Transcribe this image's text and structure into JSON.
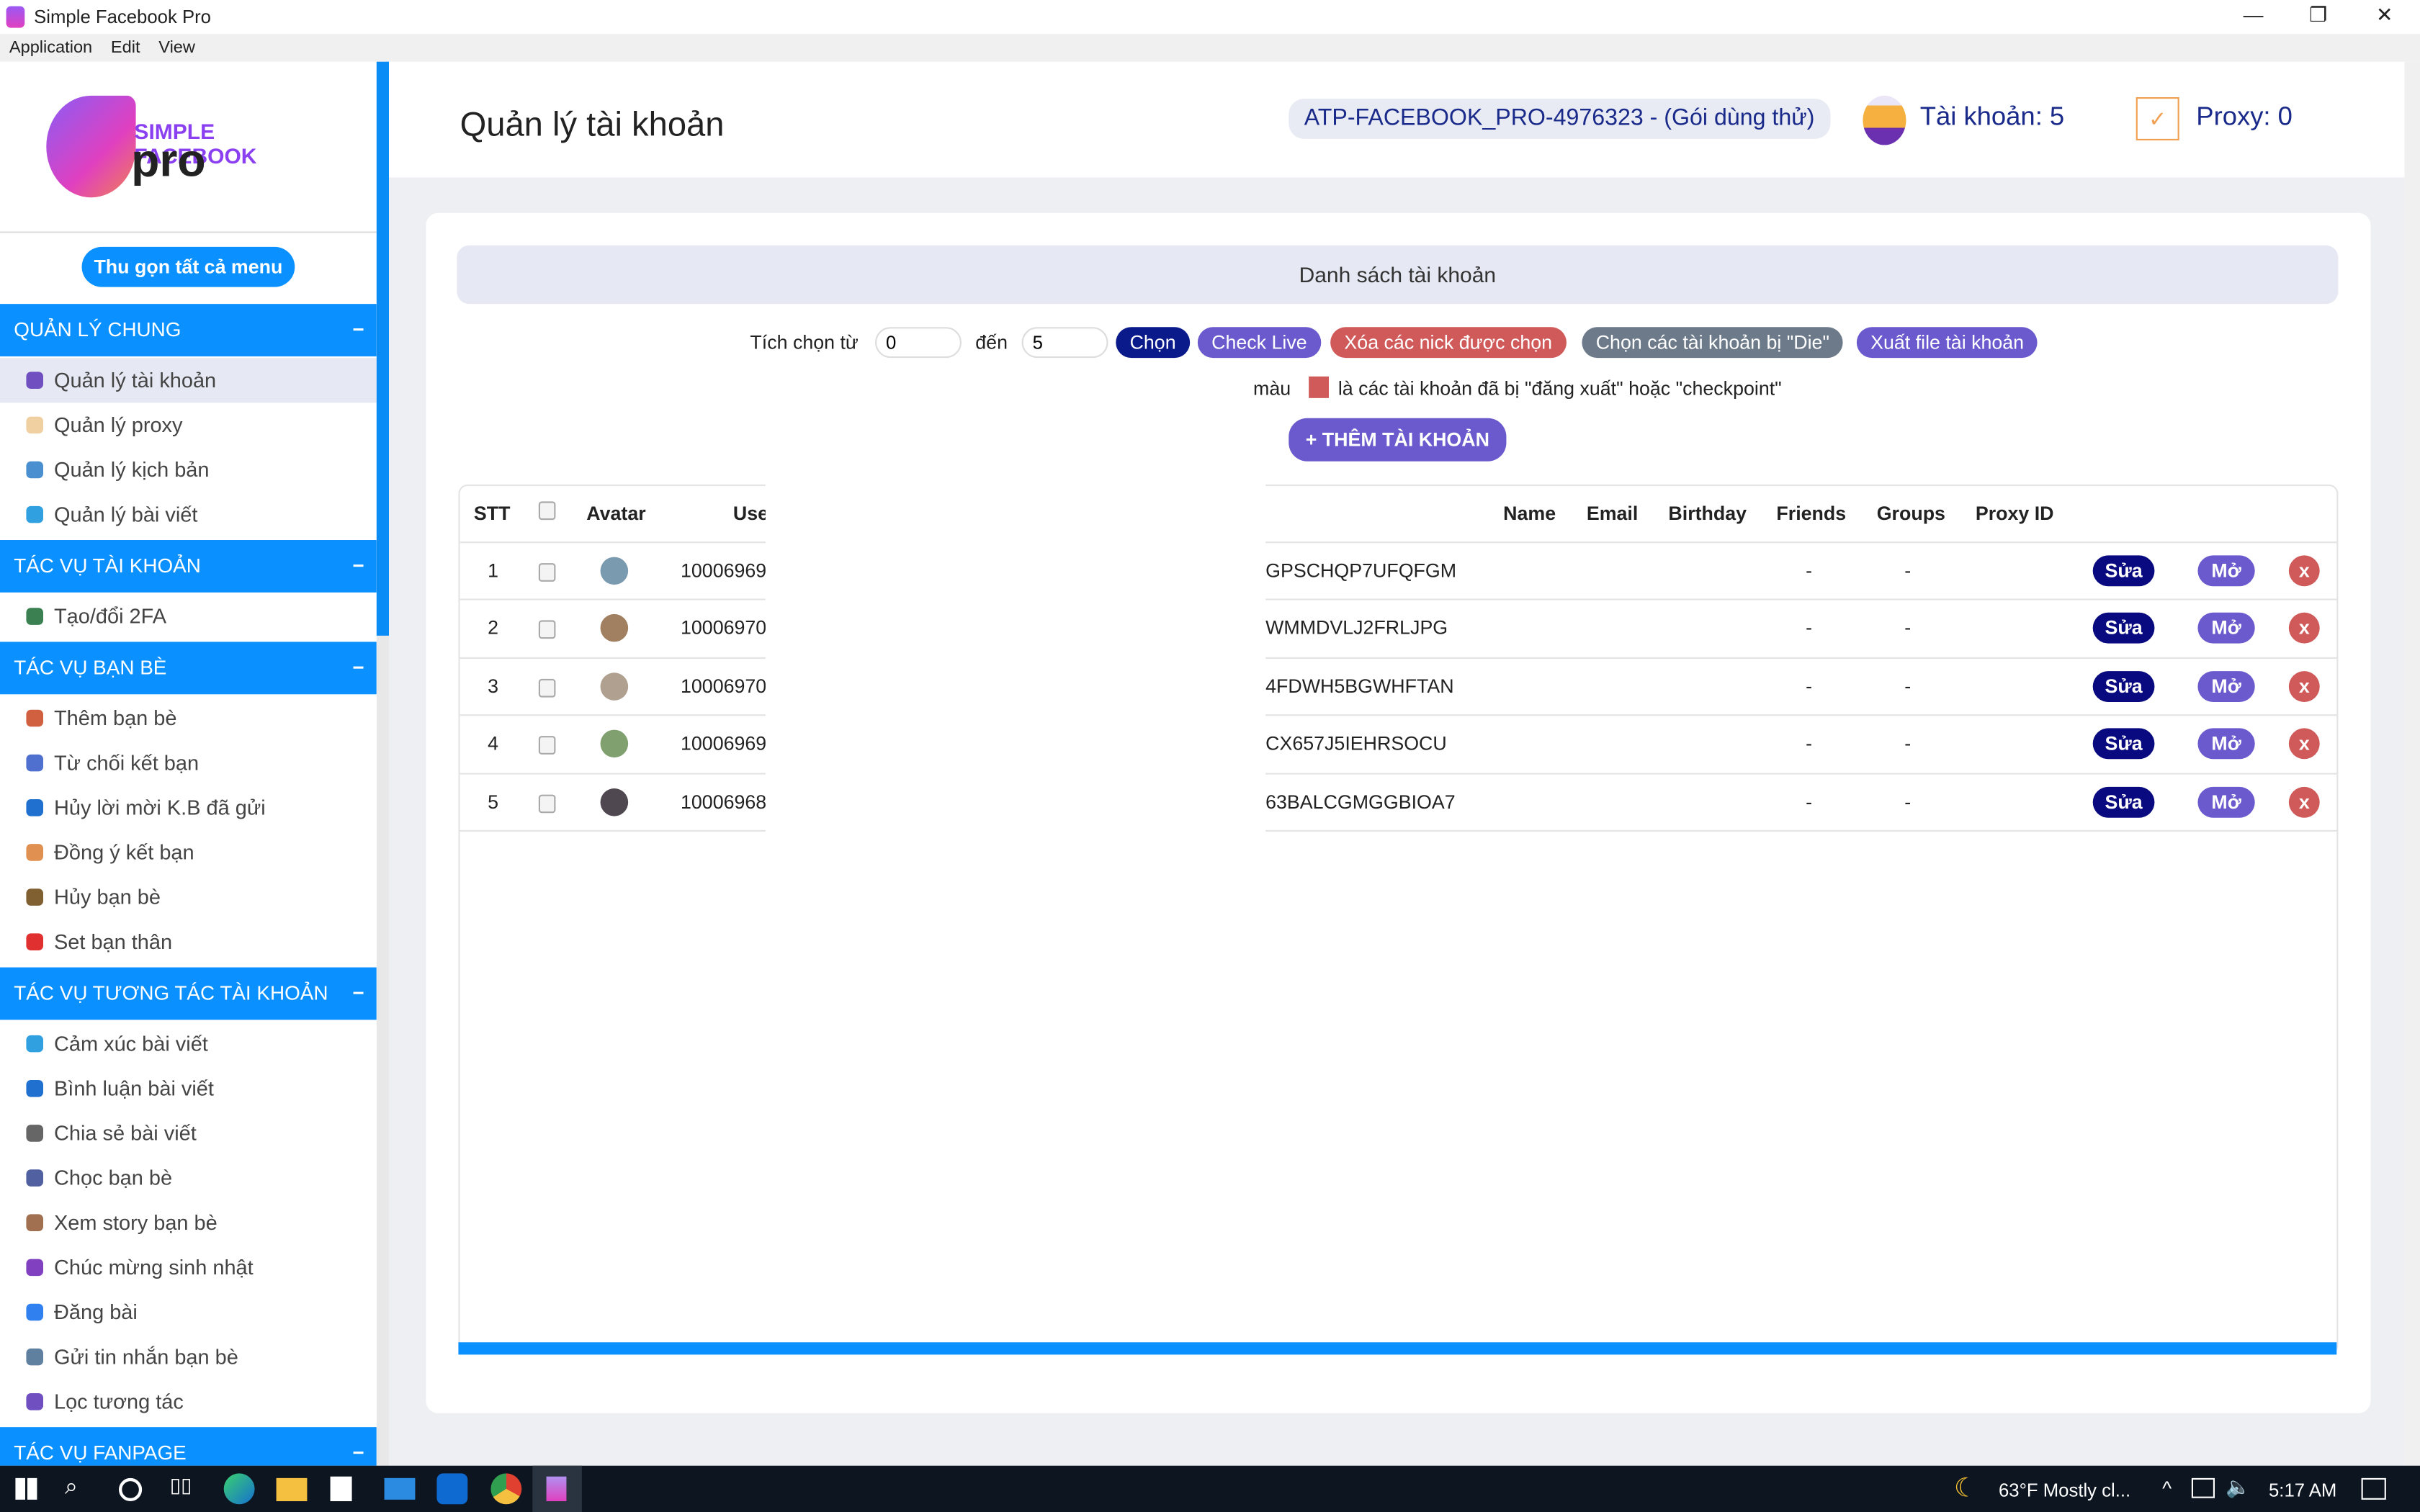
{
  "window": {
    "title": "Simple Facebook Pro",
    "menu": [
      "Application",
      "Edit",
      "View"
    ],
    "controls": {
      "minimize": "—",
      "restore": "❐",
      "close": "✕"
    }
  },
  "logo": {
    "line1": "SIMPLE FACEBOOK",
    "line2": "pro"
  },
  "sidebar": {
    "collapse_label": "Thu gọn tất cả menu",
    "sections": [
      {
        "title": "QUẢN LÝ CHUNG",
        "toggle": "−",
        "items": [
          {
            "label": "Quản lý tài khoản",
            "icon": "user-icon",
            "active": true
          },
          {
            "label": "Quản lý proxy",
            "icon": "proxy-icon"
          },
          {
            "label": "Quản lý kịch bản",
            "icon": "script-icon"
          },
          {
            "label": "Quản lý bài viết",
            "icon": "post-icon"
          }
        ]
      },
      {
        "title": "TÁC VỤ TÀI KHOẢN",
        "toggle": "−",
        "items": [
          {
            "label": "Tạo/đổi 2FA",
            "icon": "globe-key-icon"
          }
        ]
      },
      {
        "title": "TÁC VỤ BẠN BÈ",
        "toggle": "−",
        "items": [
          {
            "label": "Thêm bạn bè",
            "icon": "add-friend-icon"
          },
          {
            "label": "Từ chối kết bạn",
            "icon": "reject-friend-icon"
          },
          {
            "label": "Hủy lời mời K.B đã gửi",
            "icon": "cancel-request-icon"
          },
          {
            "label": "Đồng ý kết bạn",
            "icon": "accept-friend-icon"
          },
          {
            "label": "Hủy bạn bè",
            "icon": "unfriend-icon"
          },
          {
            "label": "Set bạn thân",
            "icon": "best-friend-icon"
          }
        ]
      },
      {
        "title": "TÁC VỤ TƯƠNG TÁC TÀI KHOẢN",
        "toggle": "−",
        "items": [
          {
            "label": "Cảm xúc bài viết",
            "icon": "heart-icon"
          },
          {
            "label": "Bình luận bài viết",
            "icon": "comment-icon"
          },
          {
            "label": "Chia sẻ bài viết",
            "icon": "share-icon"
          },
          {
            "label": "Chọc bạn bè",
            "icon": "poke-icon"
          },
          {
            "label": "Xem story bạn bè",
            "icon": "story-icon"
          },
          {
            "label": "Chúc mừng sinh nhật",
            "icon": "birthday-icon"
          },
          {
            "label": "Đăng bài",
            "icon": "post-text-icon"
          },
          {
            "label": "Gửi tin nhắn bạn bè",
            "icon": "messenger-icon"
          },
          {
            "label": "Lọc tương tác",
            "icon": "filter-icon"
          }
        ]
      },
      {
        "title": "TÁC VỤ FANPAGE",
        "toggle": "−",
        "items": []
      }
    ]
  },
  "header": {
    "title": "Quản lý tài khoản",
    "license": "ATP-FACEBOOK_PRO-4976323 - (Gói dùng thử)",
    "accounts": "Tài khoản: 5",
    "proxy": "Proxy: 0"
  },
  "panel": {
    "title": "Danh sách tài khoản",
    "select_from_label": "Tích chọn từ",
    "from_value": "0",
    "to_label": "đến",
    "to_value": "5",
    "buttons": [
      {
        "label": "Chọn",
        "color": "#0a1a8a"
      },
      {
        "label": "Check Live",
        "color": "#6a5acd"
      },
      {
        "label": "Xóa các nick được chọn",
        "color": "#d05a5a"
      },
      {
        "label": "Chọn các tài khoản bị \"Die\"",
        "color": "#6c7a89"
      },
      {
        "label": "Xuất file tài khoản",
        "color": "#6a5acd"
      }
    ],
    "legend_prefix": "màu",
    "legend_text": "là các tài khoản đã bị \"đăng xuất\" hoặc \"checkpoint\"",
    "legend_color": "#d05a5a",
    "add_button": "+ THÊM TÀI KHOẢN"
  },
  "table": {
    "columns": [
      "STT",
      "",
      "Avatar",
      "Use",
      "Name",
      "Email",
      "Birthday",
      "Friends",
      "Groups",
      "Proxy ID"
    ],
    "rows": [
      {
        "stt": "1",
        "uid": "10006969",
        "token": "GPSCHQP7UFQFGM",
        "friends": "-",
        "groups": "-"
      },
      {
        "stt": "2",
        "uid": "10006970",
        "token": "WMMDVLJ2FRLJPG",
        "friends": "-",
        "groups": "-"
      },
      {
        "stt": "3",
        "uid": "10006970",
        "token": "4FDWH5BGWHFTAN",
        "friends": "-",
        "groups": "-"
      },
      {
        "stt": "4",
        "uid": "10006969",
        "token": "CX657J5IEHRSOCU",
        "friends": "-",
        "groups": "-"
      },
      {
        "stt": "5",
        "uid": "10006968",
        "token": "63BALCGMGGBIOA7",
        "friends": "-",
        "groups": "-"
      }
    ],
    "edit_label": "Sửa",
    "open_label": "Mở",
    "delete_label": "x"
  },
  "taskbar": {
    "weather": "63°F  Mostly cl...",
    "time": "5:17 AM"
  }
}
